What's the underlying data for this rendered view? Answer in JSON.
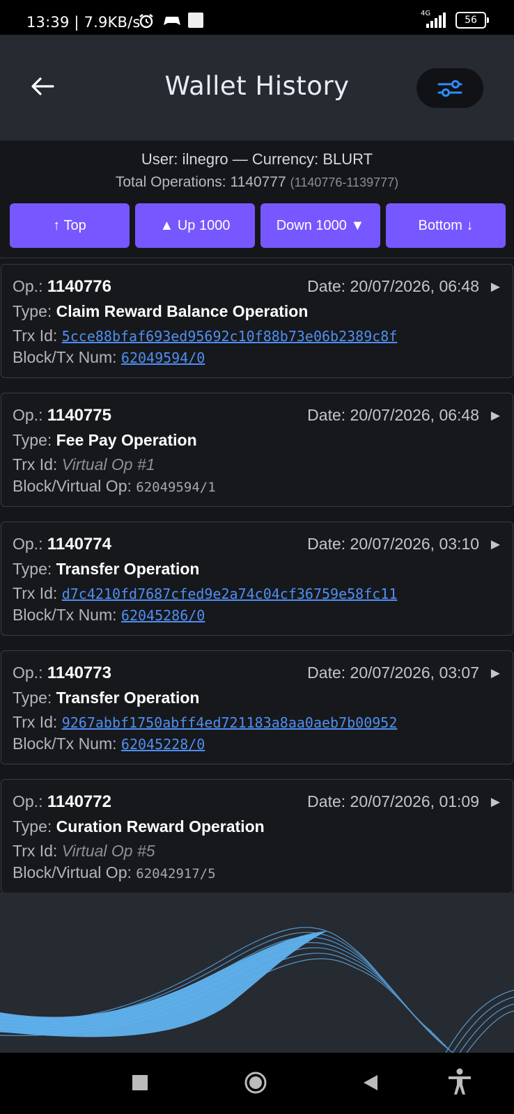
{
  "status_bar": {
    "time": "13:39 | 7.9KB/s",
    "network": "4G",
    "battery": "56"
  },
  "header": {
    "title": "Wallet History"
  },
  "summary": {
    "user_line": "User: ilnegro — Currency: BLURT",
    "total_line": "Total Operations: 1140777",
    "range": "(1140776-1139777)"
  },
  "nav_buttons": {
    "top": "↑ Top",
    "up": "▲ Up 1000",
    "down": "Down 1000 ▼",
    "bottom": "Bottom ↓"
  },
  "labels": {
    "op": "Op.: ",
    "type": "Type: ",
    "trx": "Trx Id: ",
    "block_tx": "Block/Tx Num: ",
    "block_virtual": "Block/Virtual Op: ",
    "date": "Date: "
  },
  "operations": [
    {
      "op": "1140776",
      "date": "20/07/2026, 06:48",
      "type": "Claim Reward Balance Operation",
      "trx_id": "5cce88bfaf693ed95692c10f88b73e06b2389c8f",
      "block": "62049594/0"
    },
    {
      "op": "1140775",
      "date": "20/07/2026, 06:48",
      "type": "Fee Pay Operation",
      "trx_id": "Virtual Op #1",
      "block": "62049594/1"
    },
    {
      "op": "1140774",
      "date": "20/07/2026, 03:10",
      "type": "Transfer Operation",
      "trx_id": "d7c4210fd7687cfed9e2a74c04cf36759e58fc11",
      "block": "62045286/0"
    },
    {
      "op": "1140773",
      "date": "20/07/2026, 03:07",
      "type": "Transfer Operation",
      "trx_id": "9267abbf1750abff4ed721183a8aa0aeb7b00952",
      "block": "62045228/0"
    },
    {
      "op": "1140772",
      "date": "20/07/2026, 01:09",
      "type": "Curation Reward Operation",
      "trx_id": "Virtual Op #5",
      "block": "62042917/5"
    }
  ],
  "colors": {
    "accent_button": "#7757ff",
    "link": "#4f8ff0",
    "filter_icon": "#2f8cff"
  }
}
